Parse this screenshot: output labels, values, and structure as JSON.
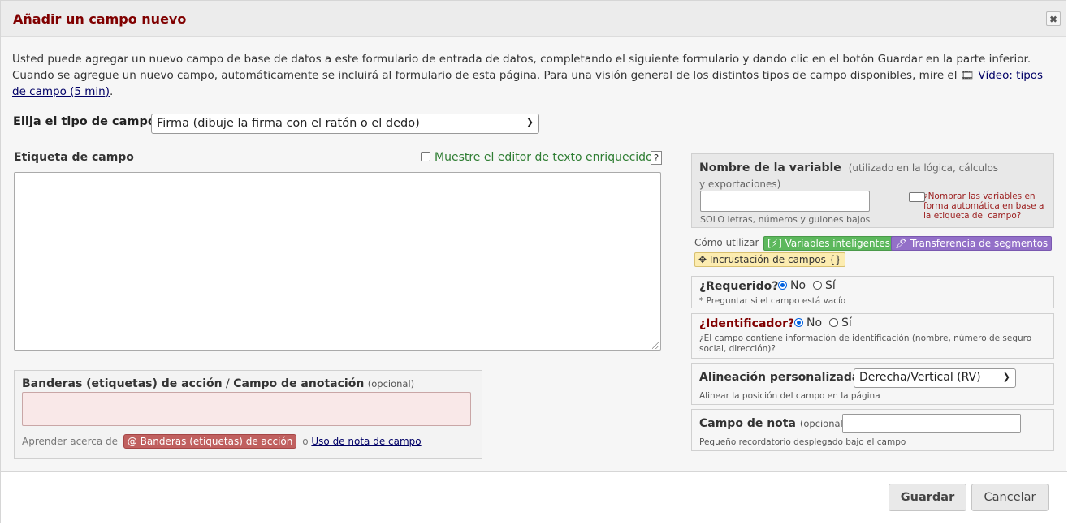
{
  "dialog": {
    "title": "Añadir un campo nuevo",
    "close_glyph": "✖"
  },
  "intro": {
    "text": "Usted puede agregar un nuevo campo de base de datos a este formulario de entrada de datos, completando el siguiente formulario y dando clic en el botón Guardar en la parte inferior. Cuando se agregue un nuevo campo, automáticamente se incluirá al formulario de esta página. Para una visión general de los distintos tipos de campo disponibles, mire el",
    "video_icon": "🎞",
    "video_link": "Vídeo: tipos de campo (5 min)",
    "end": "."
  },
  "field_type": {
    "label": "Elija el tipo de campo",
    "selected": "Firma (dibuje la firma con el ratón o el dedo)"
  },
  "field_label": {
    "label": "Etiqueta de campo",
    "rich_text": "Muestre el editor de texto enriquecido",
    "help": "?"
  },
  "action_tags": {
    "title_a": "Banderas (etiquetas) de acción",
    "sep": " / ",
    "title_b": "Campo de anotación",
    "optional": "(opcional)",
    "learn": "Aprender acerca de",
    "tag_button": "@ Banderas (etiquetas) de acción",
    "or": "o",
    "note_link": "Uso de nota de campo"
  },
  "variable": {
    "label": "Nombre de la variable",
    "sub": "(utilizado en la lógica, cálculos y exportaciones)",
    "hint": "SOLO letras, números y guiones bajos",
    "auto": "¿Nombrar las variables en forma automática en base a la etiqueta del campo?"
  },
  "howto": {
    "label": "Cómo utilizar",
    "smart": "[⚡] Variables inteligentes",
    "piping": "🖊 Transferencia de segmentos",
    "embed": "✥ Incrustación de campos {}"
  },
  "required": {
    "label": "¿Requerido?",
    "no": "No",
    "yes": "Sí",
    "hint": "* Preguntar si el campo está vacío"
  },
  "identifier": {
    "label": "¿Identificador?",
    "no": "No",
    "yes": "Sí",
    "hint": "¿El campo contiene información de identificación (nombre, número de seguro social, dirección)?"
  },
  "alignment": {
    "label": "Alineación personalizada",
    "selected": "Derecha/Vertical (RV)",
    "hint": "Alinear la posición del campo en la página"
  },
  "note": {
    "label": "Campo de nota",
    "optional": "(opcional)",
    "hint": "Pequeño recordatorio desplegado bajo el campo"
  },
  "footer": {
    "save": "Guardar",
    "cancel": "Cancelar"
  },
  "colors": {
    "title": "#800000",
    "link": "#000066",
    "rich_text": "#2e7d32",
    "auto_name": "#9b1b1b",
    "tag_green": "#5cb85c",
    "tag_purple": "#9370c8",
    "tag_yellow": "#fcecb0",
    "tag_red": "#c0605f"
  }
}
